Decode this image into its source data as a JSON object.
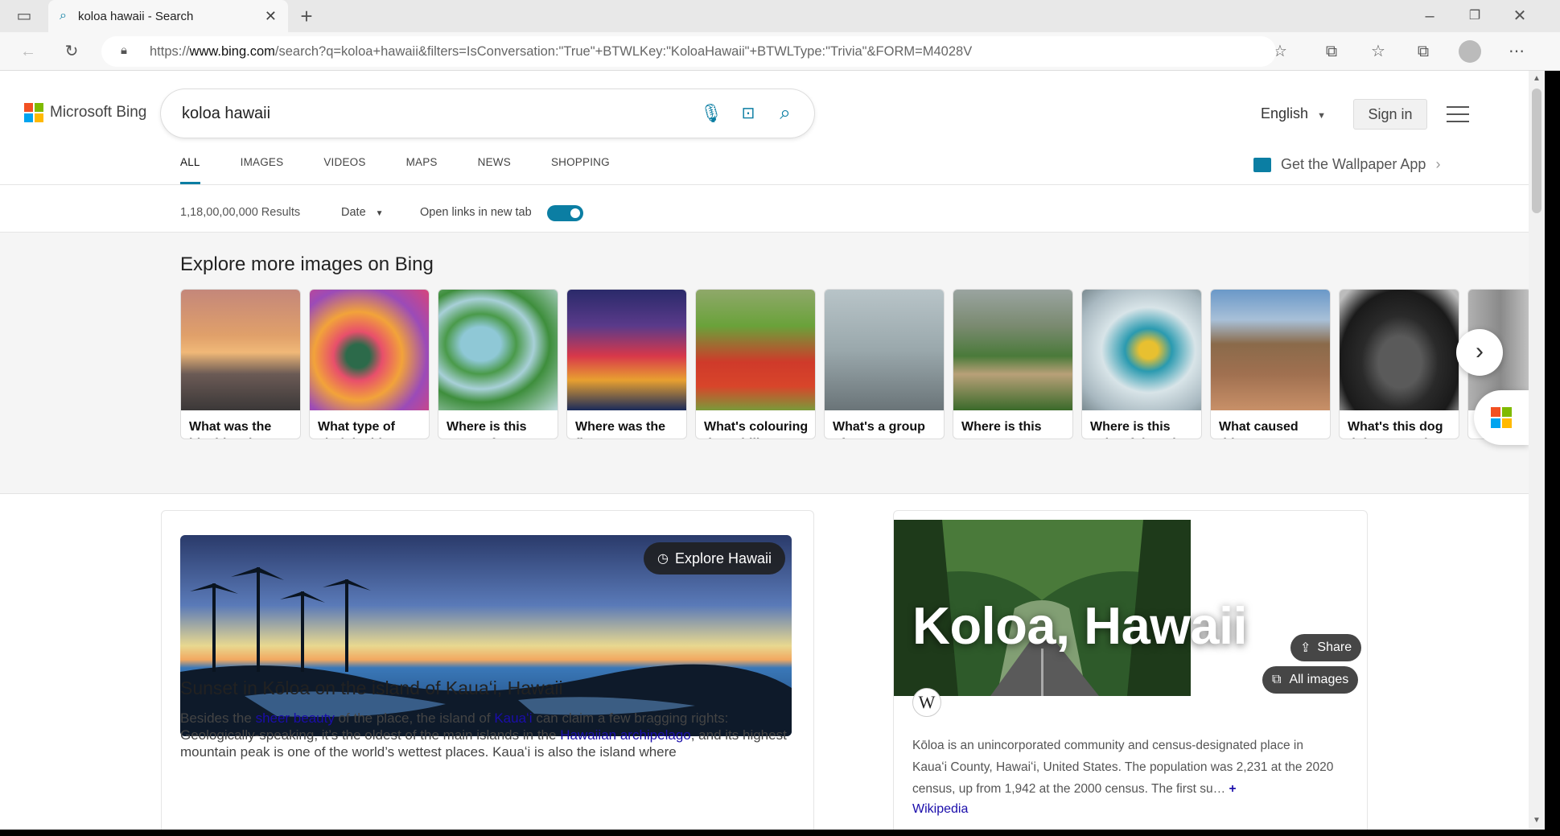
{
  "browser": {
    "tab_title": "koloa hawaii - Search",
    "url_prefix": "https://",
    "url_domain": "www.bing.com",
    "url_rest": "/search?q=koloa+hawaii&filters=IsConversation:\"True\"+BTWLKey:\"KoloaHawaii\"+BTWLType:\"Trivia\"&FORM=M4028V"
  },
  "header": {
    "logo_text": "Microsoft Bing",
    "query": "koloa hawaii",
    "language": "English",
    "sign_in": "Sign in"
  },
  "nav": {
    "tabs": [
      "ALL",
      "IMAGES",
      "VIDEOS",
      "MAPS",
      "NEWS",
      "SHOPPING"
    ],
    "wallpaper": "Get the Wallpaper App"
  },
  "filters": {
    "results": "1,18,00,00,000 Results",
    "date": "Date",
    "open_new_tab": "Open links in new tab"
  },
  "explore": {
    "title": "Explore more images on Bing",
    "cards": [
      {
        "caption": "What was the big 'blowdown' here?"
      },
      {
        "caption": "What type of cloth is this?"
      },
      {
        "caption": "Where is this watery forest?"
      },
      {
        "caption": "Where was the first US state fair?"
      },
      {
        "caption": "What's colouring these hills?"
      },
      {
        "caption": "What's a group of ravens called?"
      },
      {
        "caption": "Where is this mangrove forest?"
      },
      {
        "caption": "Where is this colourful pool?"
      },
      {
        "caption": "What caused this crater?"
      },
      {
        "caption": "What's this dog doing at work?"
      }
    ]
  },
  "main": {
    "explore_btn": "Explore Hawaii",
    "title": "Sunset in Kōloa on the island of Kauaʻi, Hawaii",
    "t1": "Besides the ",
    "l1": "sheer beauty",
    "t2": " of the place, the island of ",
    "l2": "Kauaʻi",
    "t3": " can claim a few bragging rights: Geologically-speaking, it’s the oldest of the main islands in the ",
    "l3": "Hawaiian archipelago",
    "t4": ", and its highest mountain peak is one of the world’s wettest places. Kauaʻi is also the island where"
  },
  "panel": {
    "title": "Koloa, Hawaii",
    "share": "Share",
    "all_images": "All images",
    "wiki_badge": "W",
    "text": "Kōloa is an unincorporated community and census-designated place in Kauaʻi County, Hawaiʻi, United States. The population was 2,231 at the 2020 census, up from 1,942 at the 2000 census. The first su…",
    "more": "+",
    "source": "Wikipedia"
  },
  "colors": {
    "accent": "#0b7ea3",
    "link": "#1a0dab",
    "ms_red": "#f25022",
    "ms_green": "#7fba00",
    "ms_blue": "#00a4ef",
    "ms_yellow": "#ffb900"
  }
}
